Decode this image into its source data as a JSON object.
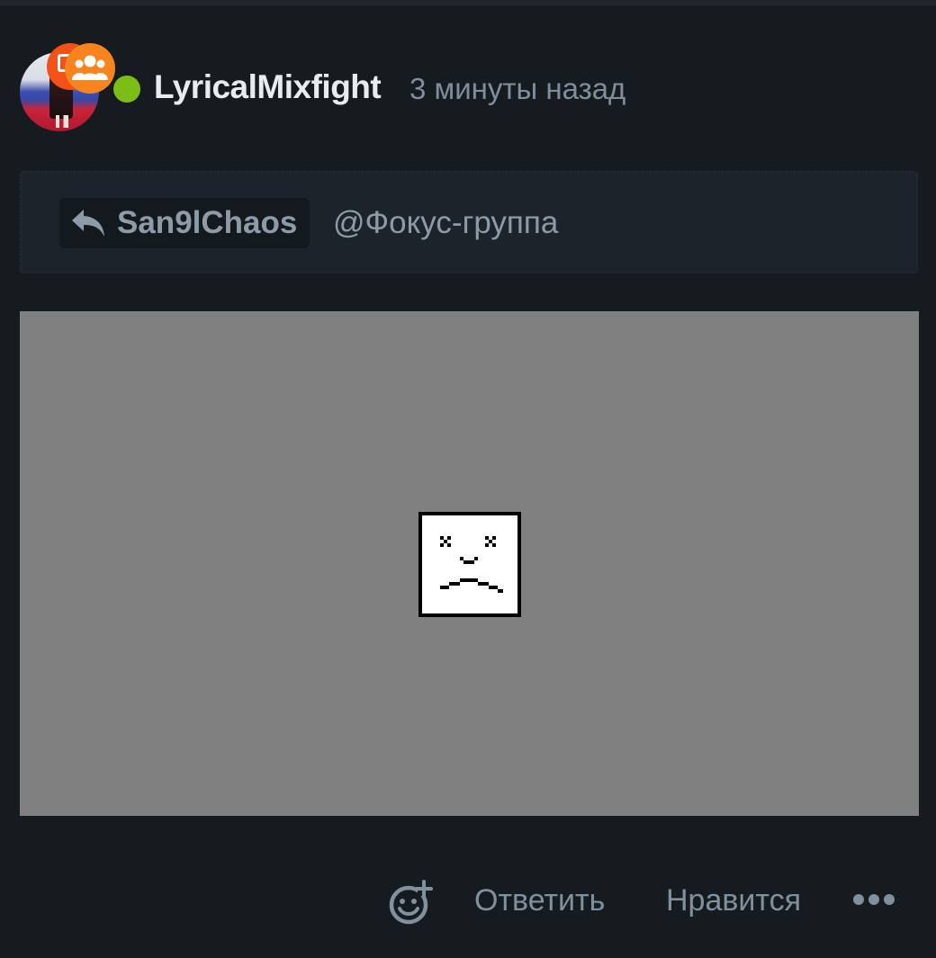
{
  "post": {
    "author": "LyricalMixfight",
    "time": "3 минуты назад",
    "online": true
  },
  "reply": {
    "to_user": "San9lChaos",
    "group": "@Фокус-группа"
  },
  "image": {
    "status": "broken-image-icon"
  },
  "actions": {
    "reply_label": "Ответить",
    "like_label": "Нравится",
    "react_icon": "emoji-add-icon",
    "more_icon": "more-dots-icon"
  },
  "colors": {
    "background": "#161b20",
    "online": "#7cbd16",
    "badge_orange": "#f7841f",
    "badge_red": "#f25118",
    "muted_text": "#7f909e"
  }
}
